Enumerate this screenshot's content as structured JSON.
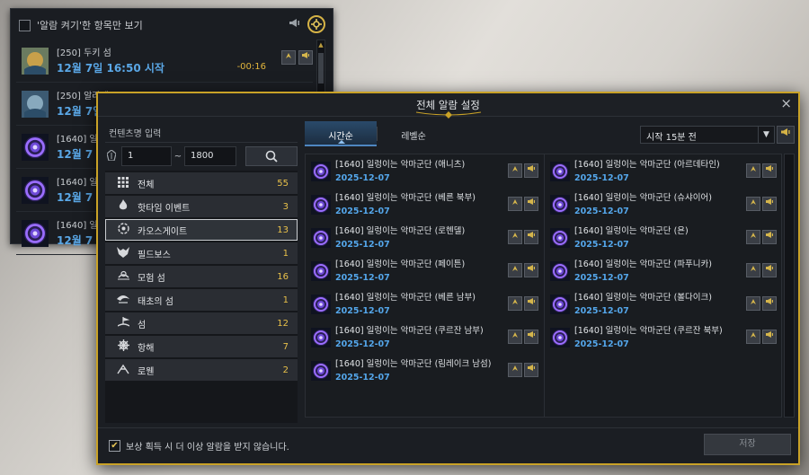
{
  "back_panel": {
    "title": "'알람 켜기'한 항목만 보기",
    "items": [
      {
        "name": "[250] 두키 섬",
        "date": "12월 7일 16:50 시작",
        "timer": "-00:16"
      },
      {
        "name": "[250] 알라케르",
        "date": "12월 7일"
      },
      {
        "name": "[1640] 일",
        "date": "12월 7"
      },
      {
        "name": "[1640] 일",
        "date": "12월 7"
      },
      {
        "name": "[1640] 일",
        "date": "12월 7"
      }
    ]
  },
  "dialog": {
    "title": "전체 알람 설정",
    "close": "×",
    "content_input_label": "컨텐츠명 입력",
    "range_min": "1",
    "range_tilde": "~",
    "range_max": "1800",
    "categories": [
      {
        "icon": "grid-icon",
        "label": "전체",
        "count": "55"
      },
      {
        "icon": "fire-icon",
        "label": "핫타임 이벤트",
        "count": "3"
      },
      {
        "icon": "chaos-gate-icon",
        "label": "카오스게이트",
        "count": "13"
      },
      {
        "icon": "field-boss-icon",
        "label": "필드보스",
        "count": "1"
      },
      {
        "icon": "island-icon",
        "label": "모험 섬",
        "count": "16"
      },
      {
        "icon": "origin-island-icon",
        "label": "태초의 섬",
        "count": "1"
      },
      {
        "icon": "island-small-icon",
        "label": "섬",
        "count": "12"
      },
      {
        "icon": "sail-icon",
        "label": "항해",
        "count": "7"
      },
      {
        "icon": "rowen-icon",
        "label": "로웬",
        "count": "2"
      }
    ],
    "tabs": [
      "시간순",
      "레벨순"
    ],
    "dropdown": "시작 15분 전",
    "events_left": [
      {
        "name": "[1640] 일렁이는 악마군단 (애니츠)",
        "date": "2025-12-07"
      },
      {
        "name": "[1640] 일렁이는 악마군단 (베른 북부)",
        "date": "2025-12-07"
      },
      {
        "name": "[1640] 일렁이는 악마군단 (로헨델)",
        "date": "2025-12-07"
      },
      {
        "name": "[1640] 일렁이는 악마군단 (페이튼)",
        "date": "2025-12-07"
      },
      {
        "name": "[1640] 일렁이는 악마군단 (베른 남부)",
        "date": "2025-12-07"
      },
      {
        "name": "[1640] 일렁이는 악마군단 (쿠르잔 남부)",
        "date": "2025-12-07"
      },
      {
        "name": "[1640] 일렁이는 악마군단 (림레이크 남섬)",
        "date": "2025-12-07"
      }
    ],
    "events_right": [
      {
        "name": "[1640] 일렁이는 악마군단 (아르데타인)",
        "date": "2025-12-07"
      },
      {
        "name": "[1640] 일렁이는 악마군단 (슈샤이어)",
        "date": "2025-12-07"
      },
      {
        "name": "[1640] 일렁이는 악마군단 (욘)",
        "date": "2025-12-07"
      },
      {
        "name": "[1640] 일렁이는 악마군단 (파푸니카)",
        "date": "2025-12-07"
      },
      {
        "name": "[1640] 일렁이는 악마군단 (볼다이크)",
        "date": "2025-12-07"
      },
      {
        "name": "[1640] 일렁이는 악마군단 (쿠르잔 북부)",
        "date": "2025-12-07"
      }
    ],
    "footer_checkbox": "보상 획득 시 더 이상 알람을 받지 않습니다.",
    "save": "저장"
  }
}
